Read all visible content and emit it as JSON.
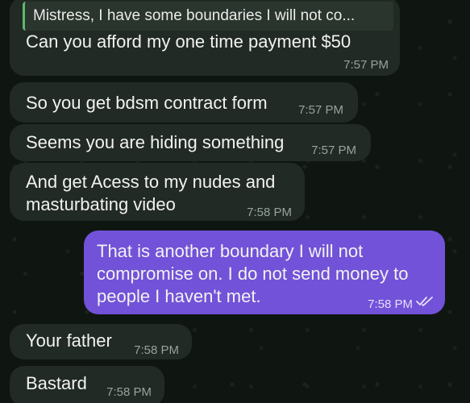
{
  "messages": [
    {
      "reply_quote": "Mistress, I have some boundaries I will not co...",
      "text": "Can you afford my one time payment $50",
      "time": "7:57 PM"
    },
    {
      "text": "So you get bdsm contract form",
      "time": "7:57 PM"
    },
    {
      "text": "Seems you are hiding something",
      "time": "7:57 PM"
    },
    {
      "text_line1": "And get Acess to my nudes and",
      "text_line2": "masturbating video",
      "time": "7:58 PM"
    },
    {
      "text_line1": "That is another boundary I will not",
      "text_line2": "compromise on. I do not send money to",
      "text_line3": "people I haven't met.",
      "time": "7:58 PM",
      "status_icon": "double-check-icon"
    },
    {
      "text": "Your father",
      "time": "7:58 PM"
    },
    {
      "text": "Bastard",
      "time": "7:58 PM"
    }
  ],
  "colors": {
    "incoming": "#212a24",
    "outgoing": "#7252d8",
    "reply_accent": "#5fb86f",
    "background": "#0f1612"
  }
}
